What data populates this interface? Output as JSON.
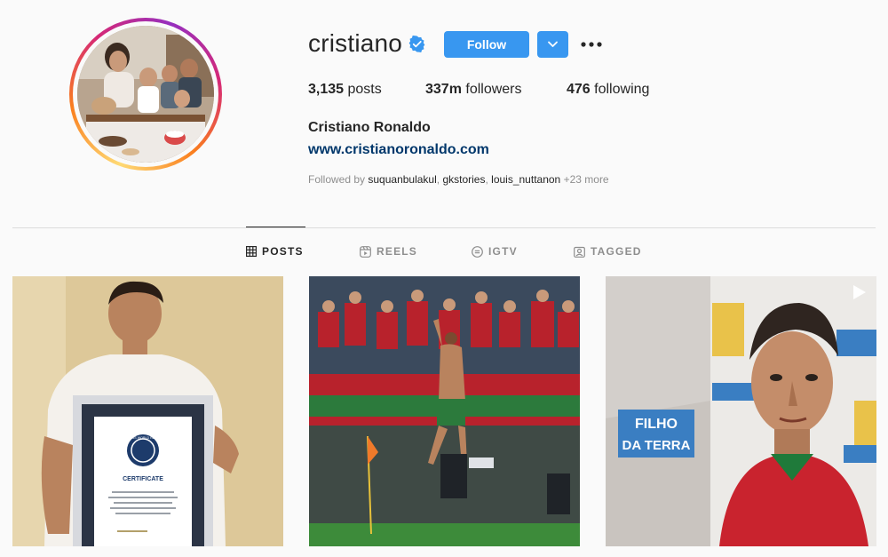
{
  "profile": {
    "username": "cristiano",
    "verified": true,
    "follow_label": "Follow",
    "posts_count": "3,135",
    "posts_label": "posts",
    "followers_count": "337m",
    "followers_label": "followers",
    "following_count": "476",
    "following_label": "following",
    "full_name": "Cristiano Ronaldo",
    "website": "www.cristianoronaldo.com",
    "followed_by_prefix": "Followed by",
    "followed_by": [
      "suquanbulakul",
      "gkstories",
      "louis_nuttanon"
    ],
    "followed_by_more": "+23 more"
  },
  "tabs": [
    {
      "label": "POSTS",
      "icon": "grid-icon",
      "active": true
    },
    {
      "label": "REELS",
      "icon": "reels-icon",
      "active": false
    },
    {
      "label": "IGTV",
      "icon": "igtv-icon",
      "active": false
    },
    {
      "label": "TAGGED",
      "icon": "tagged-icon",
      "active": false
    }
  ],
  "posts": [
    {
      "kind": "image",
      "text": {
        "cert_title": "GUINNESS WORLD RECORDS",
        "cert_label": "CERTIFICATE"
      }
    },
    {
      "kind": "image"
    },
    {
      "kind": "video",
      "text": {
        "sign_line1": "FILHO",
        "sign_line2": "DA TERRA"
      }
    }
  ],
  "colors": {
    "accent": "#3897f0",
    "link": "#00376b",
    "muted": "#8e8e8e",
    "text": "#262626",
    "divider": "#dbdbdb"
  }
}
